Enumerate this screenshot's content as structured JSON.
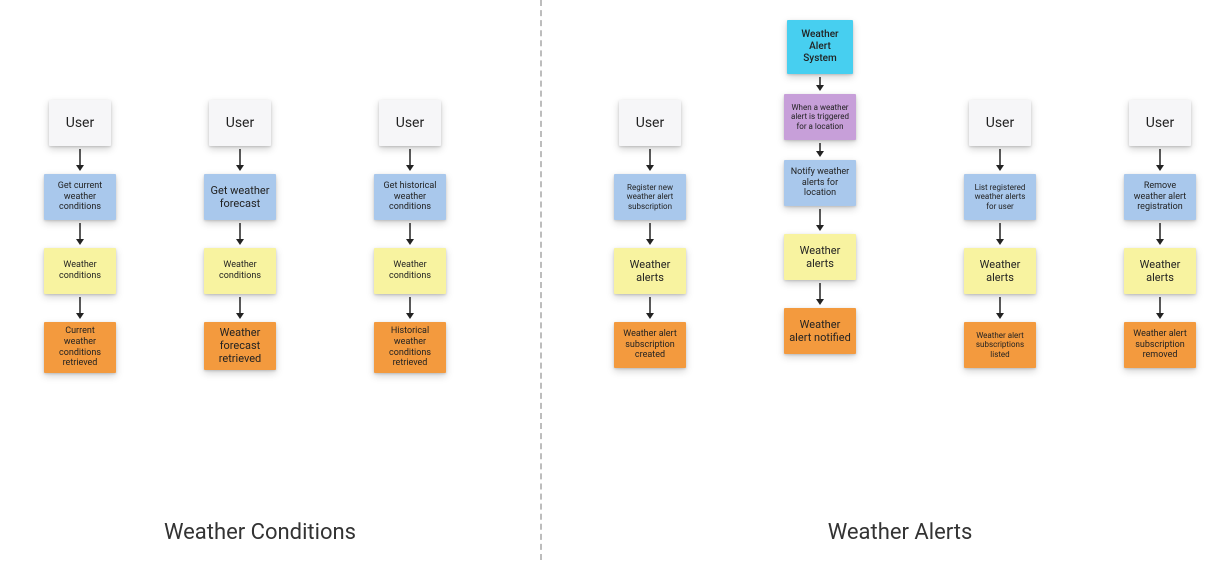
{
  "sections": {
    "left": {
      "title": "Weather Conditions"
    },
    "right": {
      "title": "Weather Alerts"
    }
  },
  "flows": {
    "f1": {
      "actor": "User",
      "action": "Get current weather conditions",
      "aggregate": "Weather conditions",
      "outcome": "Current weather conditions retrieved"
    },
    "f2": {
      "actor": "User",
      "action": "Get weather forecast",
      "aggregate": "Weather conditions",
      "outcome": "Weather forecast retrieved"
    },
    "f3": {
      "actor": "User",
      "action": "Get historical weather conditions",
      "aggregate": "Weather conditions",
      "outcome": "Historical weather conditions retrieved"
    },
    "f4": {
      "actor": "User",
      "action": "Register new weather alert subscription",
      "aggregate": "Weather alerts",
      "outcome": "Weather alert subscription created"
    },
    "f5": {
      "actor": "Weather Alert System",
      "trigger": "When a weather alert is triggered for a location",
      "action": "Notify weather alerts for location",
      "aggregate": "Weather alerts",
      "outcome": "Weather alert notified"
    },
    "f6": {
      "actor": "User",
      "action": "List registered weather alerts for user",
      "aggregate": "Weather alerts",
      "outcome": "Weather alert subscriptions listed"
    },
    "f7": {
      "actor": "User",
      "action": "Remove weather alert registration",
      "aggregate": "Weather alerts",
      "outcome": "Weather alert subscription removed"
    }
  }
}
